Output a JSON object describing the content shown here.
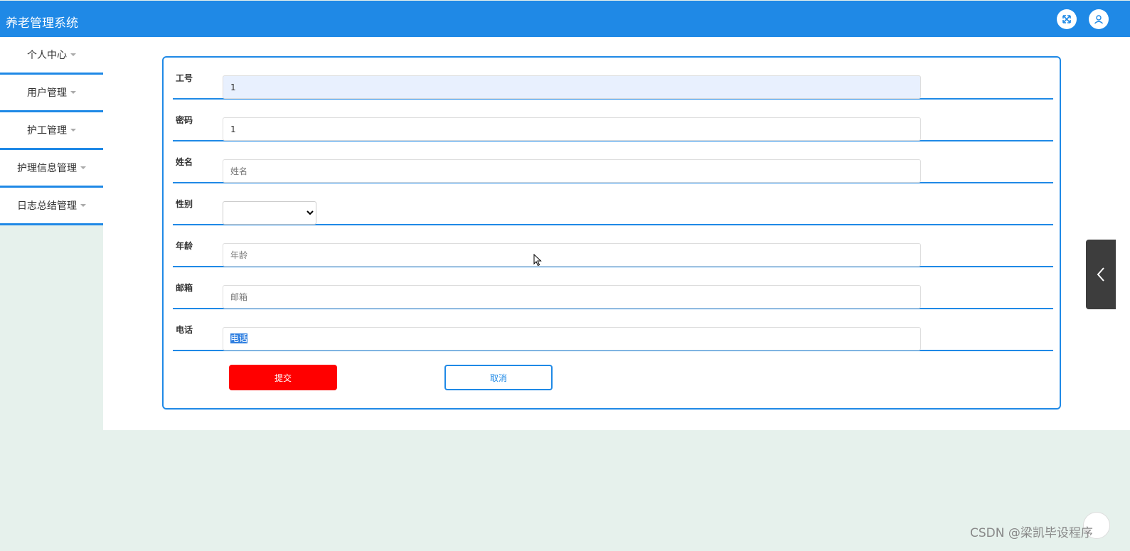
{
  "header": {
    "title": "养老管理系统"
  },
  "sidebar": {
    "items": [
      {
        "label": "个人中心"
      },
      {
        "label": "用户管理"
      },
      {
        "label": "护工管理"
      },
      {
        "label": "护理信息管理"
      },
      {
        "label": "日志总结管理"
      }
    ]
  },
  "form": {
    "job_no": {
      "label": "工号",
      "value": "1"
    },
    "password": {
      "label": "密码",
      "value": "1"
    },
    "name": {
      "label": "姓名",
      "placeholder": "姓名"
    },
    "gender": {
      "label": "性别",
      "selected": ""
    },
    "age": {
      "label": "年龄",
      "placeholder": "年龄"
    },
    "email": {
      "label": "邮箱",
      "placeholder": "邮箱"
    },
    "phone": {
      "label": "电话",
      "selected_text": "电话"
    },
    "submit_label": "提交",
    "cancel_label": "取消"
  },
  "watermark": "CSDN @梁凯毕设程序",
  "colors": {
    "primary": "#1f89e6",
    "submit": "#ff0000",
    "page_bg": "#e6f1ec"
  }
}
